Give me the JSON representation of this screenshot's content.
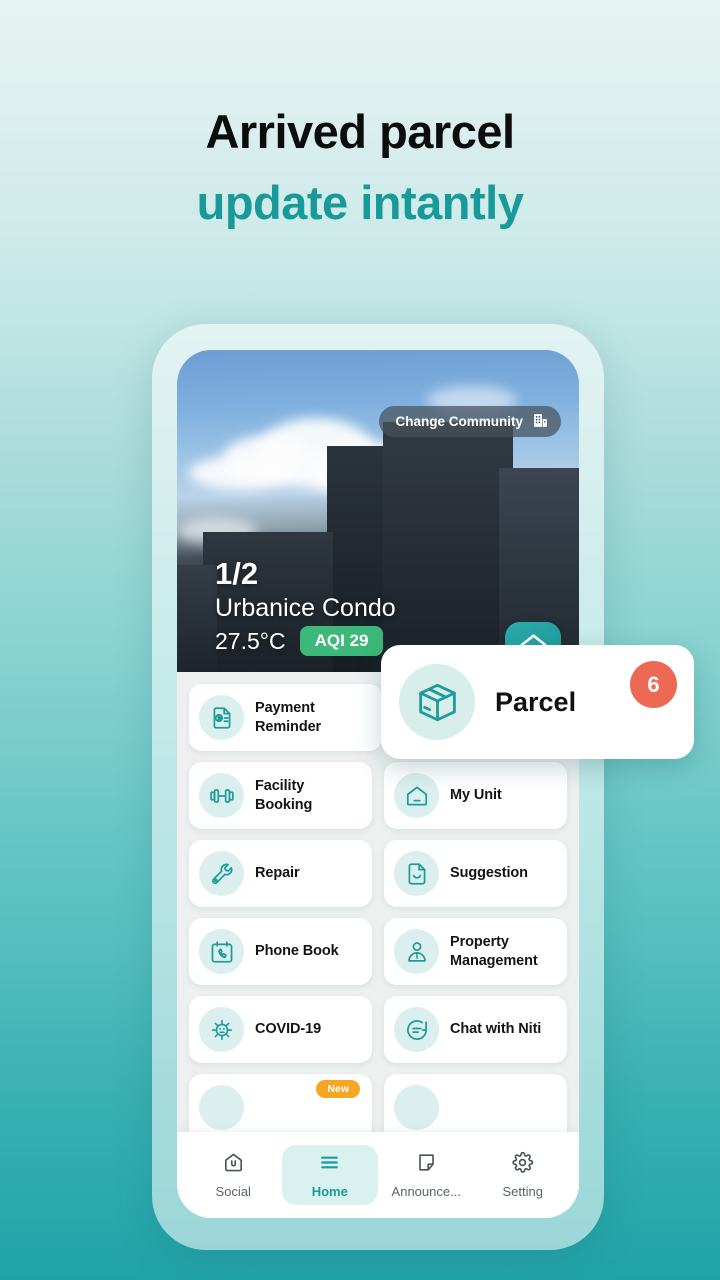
{
  "headline": {
    "line1": "Arrived parcel",
    "line2": "update intantly",
    "accent_color": "#189a9b"
  },
  "hero": {
    "change_community_label": "Change Community",
    "change_community_icon": "building-icon",
    "slide_counter": "1/2",
    "community_name": "Urbanice Condo",
    "temperature": "27.5°C",
    "aqi_badge": "AQI 29",
    "aqi_badge_color": "#3cb878",
    "app_logo_icon": "home-u-logo-icon"
  },
  "parcel": {
    "label": "Parcel",
    "badge_count": "6",
    "badge_color": "#ec6a55",
    "icon": "parcel-box-icon"
  },
  "menu": {
    "rows": [
      [
        {
          "label": "Payment Reminder",
          "icon": "invoice-baht-icon"
        }
      ],
      [
        {
          "label": "Facility Booking",
          "icon": "dumbbell-icon"
        },
        {
          "label": "My Unit",
          "icon": "house-icon"
        }
      ],
      [
        {
          "label": "Repair",
          "icon": "wrench-icon"
        },
        {
          "label": "Suggestion",
          "icon": "document-smile-icon"
        }
      ],
      [
        {
          "label": "Phone Book",
          "icon": "phone-calendar-icon"
        },
        {
          "label": "Property Management",
          "icon": "person-manager-icon"
        }
      ],
      [
        {
          "label": "COVID-19",
          "icon": "virus-icon"
        },
        {
          "label": "Chat with Niti",
          "icon": "chat-bubble-icon"
        }
      ]
    ],
    "new_badge_label": "New",
    "new_badge_color": "#f5a623",
    "icon_color": "#1f9b9b",
    "icon_bg_color": "#dbf0ee"
  },
  "bottom_nav": {
    "items": [
      {
        "label": "Social",
        "icon": "social-home-icon",
        "active": false
      },
      {
        "label": "Home",
        "icon": "menu-lines-icon",
        "active": true
      },
      {
        "label": "Announce...",
        "icon": "announcement-note-icon",
        "active": false
      },
      {
        "label": "Setting",
        "icon": "gear-icon",
        "active": false
      }
    ],
    "active_color": "#1d9b9c"
  }
}
